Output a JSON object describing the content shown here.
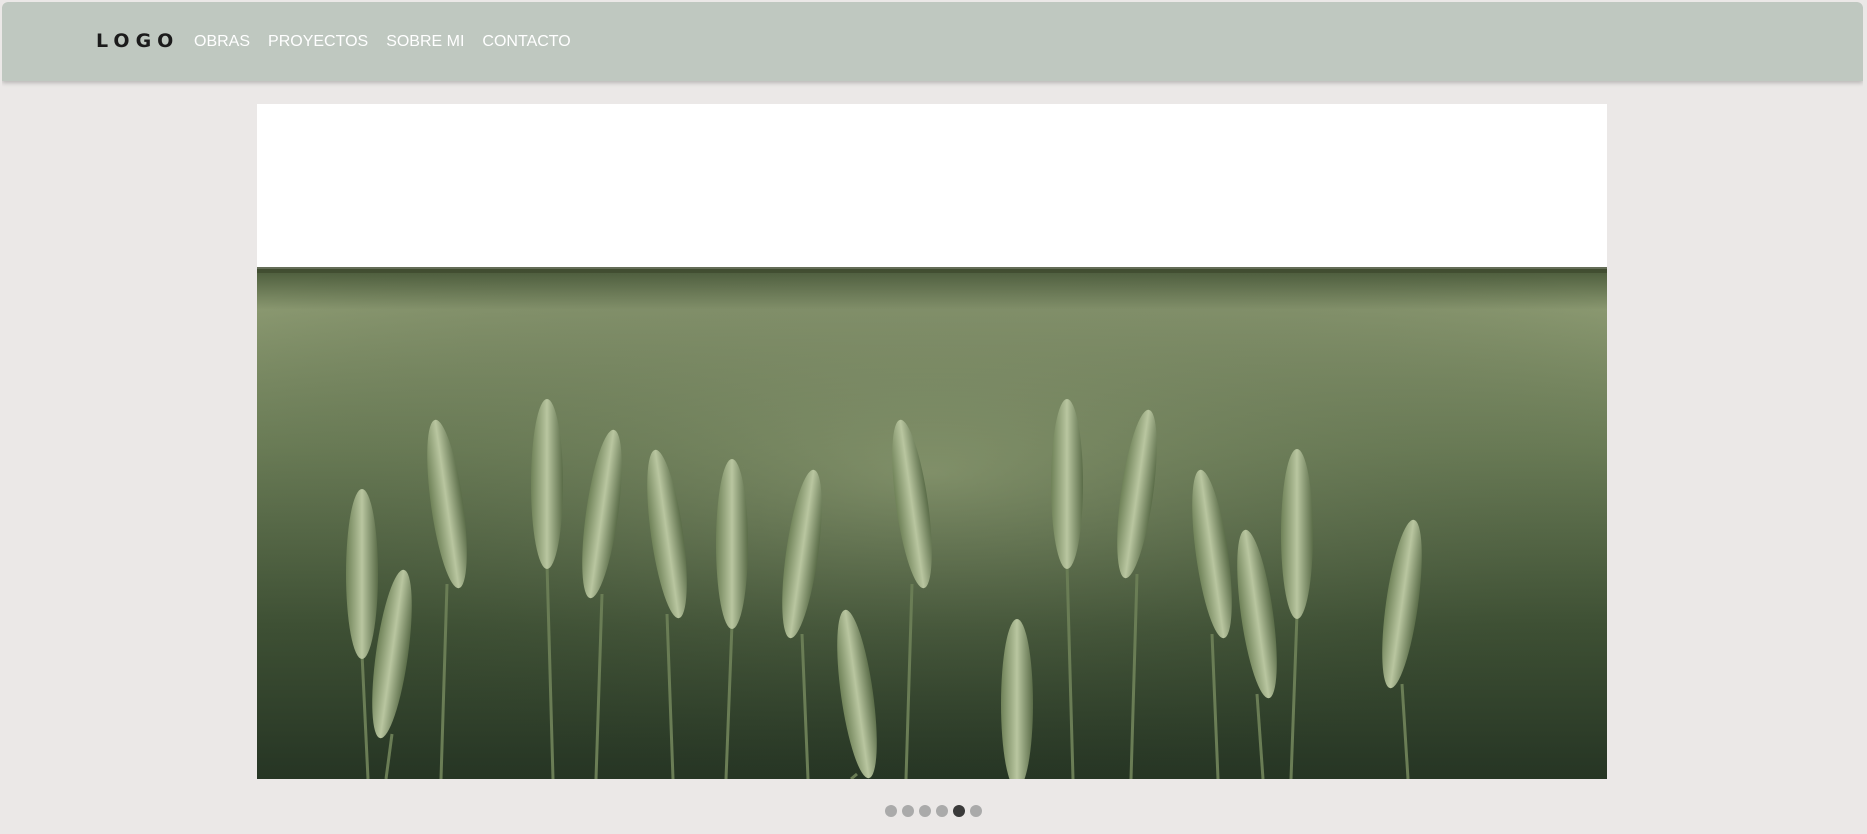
{
  "navbar": {
    "logo": "LOGO",
    "links": [
      {
        "label": "OBRAS"
      },
      {
        "label": "PROYECTOS"
      },
      {
        "label": "SOBRE MI"
      },
      {
        "label": "CONTACTO"
      }
    ]
  },
  "slider": {
    "image_subject": "wheat field photo",
    "slide_count": 6,
    "active_slide": 5
  },
  "colors": {
    "navbar_bg": "#bfc8c0",
    "page_bg": "#ebe8e7",
    "dot_inactive": "#aaaaaa",
    "dot_active": "#3a3a3a"
  }
}
